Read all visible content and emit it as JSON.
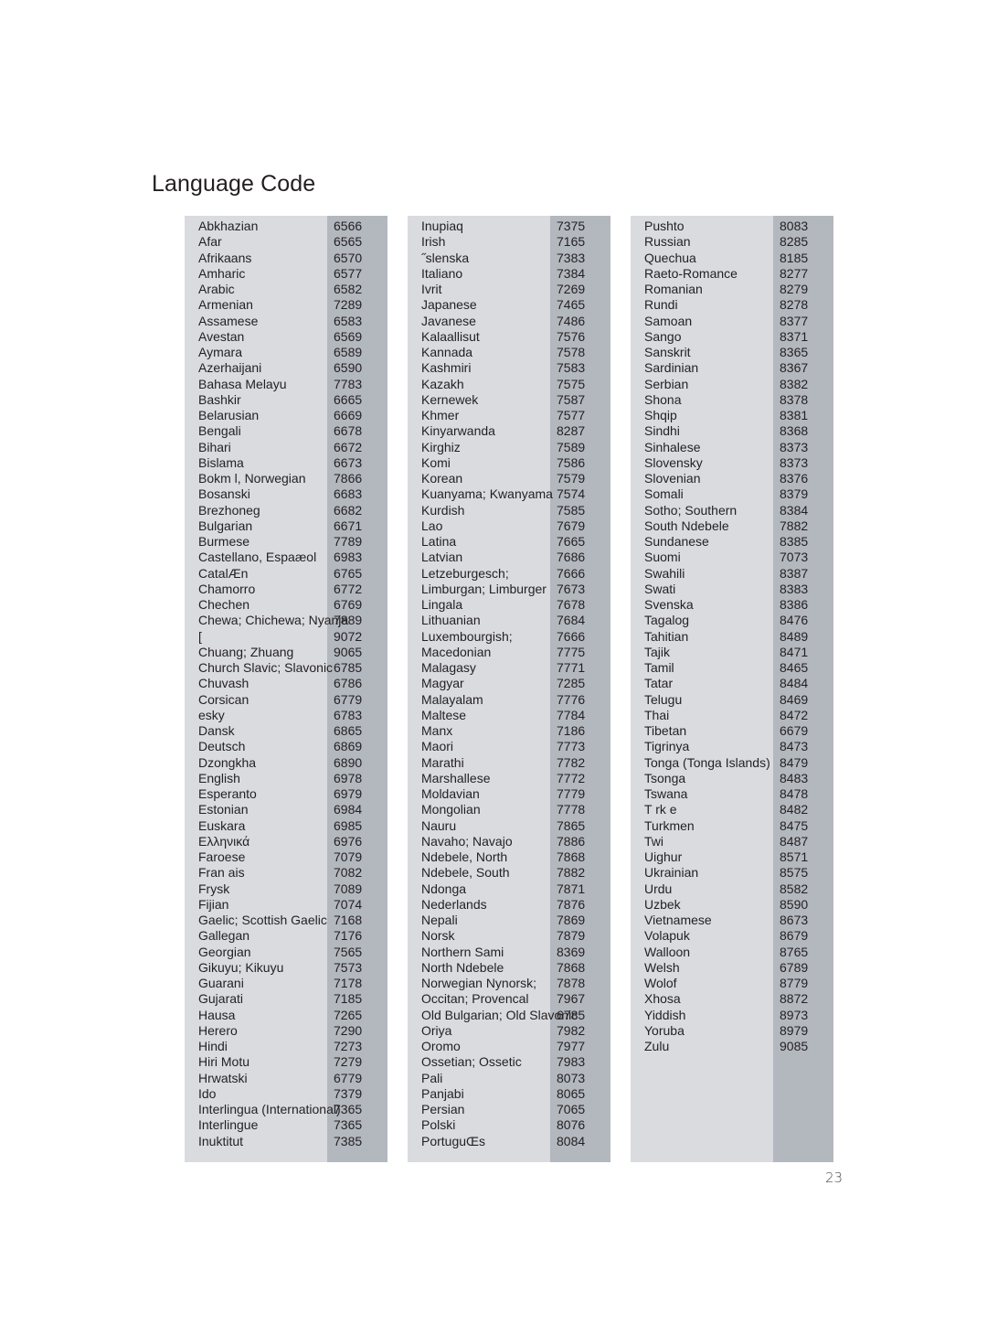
{
  "title": "Language Code",
  "page_number": "23",
  "colors": {
    "panel": "#d9dbdf",
    "code_band": "#b3b8bf",
    "text": "#231f20"
  },
  "columns": [
    {
      "rows": [
        {
          "name": "Abkhazian",
          "code": "6566"
        },
        {
          "name": "Afar",
          "code": "6565"
        },
        {
          "name": "Afrikaans",
          "code": "6570"
        },
        {
          "name": "Amharic",
          "code": "6577"
        },
        {
          "name": "Arabic",
          "code": "6582"
        },
        {
          "name": "Armenian",
          "code": "7289"
        },
        {
          "name": "Assamese",
          "code": "6583"
        },
        {
          "name": "Avestan",
          "code": "6569"
        },
        {
          "name": "Aymara",
          "code": "6589"
        },
        {
          "name": "Azerhaijani",
          "code": "6590"
        },
        {
          "name": "Bahasa Melayu",
          "code": "7783"
        },
        {
          "name": "Bashkir",
          "code": "6665"
        },
        {
          "name": "Belarusian",
          "code": "6669"
        },
        {
          "name": "Bengali",
          "code": "6678"
        },
        {
          "name": "Bihari",
          "code": "6672"
        },
        {
          "name": "Bislama",
          "code": "6673"
        },
        {
          "name": "Bokm l, Norwegian",
          "code": "7866"
        },
        {
          "name": "Bosanski",
          "code": "6683"
        },
        {
          "name": "Brezhoneg",
          "code": "6682"
        },
        {
          "name": "Bulgarian",
          "code": "6671"
        },
        {
          "name": "Burmese",
          "code": "7789"
        },
        {
          "name": "Castellano, Espaæol",
          "code": "6983"
        },
        {
          "name": "CatalÆn",
          "code": "6765"
        },
        {
          "name": "Chamorro",
          "code": "6772"
        },
        {
          "name": "Chechen",
          "code": "6769"
        },
        {
          "name": "Chewa; Chichewa; Nyanja",
          "code": "7889"
        },
        {
          "name": "  [",
          "code": "9072"
        },
        {
          "name": "Chuang; Zhuang",
          "code": "9065"
        },
        {
          "name": "Church Slavic; Slavonic",
          "code": "6785"
        },
        {
          "name": "Chuvash",
          "code": "6786"
        },
        {
          "name": "Corsican",
          "code": "6779"
        },
        {
          "name": " esky",
          "code": "6783"
        },
        {
          "name": "Dansk",
          "code": "6865"
        },
        {
          "name": "Deutsch",
          "code": "6869"
        },
        {
          "name": "Dzongkha",
          "code": "6890"
        },
        {
          "name": "English",
          "code": "6978"
        },
        {
          "name": "Esperanto",
          "code": "6979"
        },
        {
          "name": "Estonian",
          "code": "6984"
        },
        {
          "name": "Euskara",
          "code": "6985"
        },
        {
          "name": "Ελληνικά",
          "code": "6976"
        },
        {
          "name": "Faroese",
          "code": "7079"
        },
        {
          "name": "Fran ais",
          "code": "7082"
        },
        {
          "name": "Frysk",
          "code": "7089"
        },
        {
          "name": "Fijian",
          "code": "7074"
        },
        {
          "name": "Gaelic; Scottish Gaelic",
          "code": "7168"
        },
        {
          "name": "Gallegan",
          "code": "7176"
        },
        {
          "name": "Georgian",
          "code": "7565"
        },
        {
          "name": "Gikuyu; Kikuyu",
          "code": "7573"
        },
        {
          "name": "Guarani",
          "code": "7178"
        },
        {
          "name": "Gujarati",
          "code": "7185"
        },
        {
          "name": "Hausa",
          "code": "7265"
        },
        {
          "name": "Herero",
          "code": "7290"
        },
        {
          "name": "Hindi",
          "code": "7273"
        },
        {
          "name": "Hiri Motu",
          "code": "7279"
        },
        {
          "name": "Hrwatski",
          "code": "6779"
        },
        {
          "name": "Ido",
          "code": "7379"
        },
        {
          "name": "Interlingua (International)",
          "code": "7365"
        },
        {
          "name": "Interlingue",
          "code": "7365"
        },
        {
          "name": "Inuktitut",
          "code": "7385"
        }
      ]
    },
    {
      "rows": [
        {
          "name": "Inupiaq",
          "code": "7375"
        },
        {
          "name": "Irish",
          "code": "7165"
        },
        {
          "name": "˝slenska",
          "code": "7383"
        },
        {
          "name": "Italiano",
          "code": "7384"
        },
        {
          "name": "Ivrit",
          "code": "7269"
        },
        {
          "name": "Japanese",
          "code": "7465"
        },
        {
          "name": "Javanese",
          "code": "7486"
        },
        {
          "name": "Kalaallisut",
          "code": "7576"
        },
        {
          "name": "Kannada",
          "code": "7578"
        },
        {
          "name": "Kashmiri",
          "code": "7583"
        },
        {
          "name": "Kazakh",
          "code": "7575"
        },
        {
          "name": "Kernewek",
          "code": "7587"
        },
        {
          "name": "Khmer",
          "code": "7577"
        },
        {
          "name": "Kinyarwanda",
          "code": "8287"
        },
        {
          "name": "Kirghiz",
          "code": "7589"
        },
        {
          "name": "Komi",
          "code": "7586"
        },
        {
          "name": "Korean",
          "code": "7579"
        },
        {
          "name": "Kuanyama; Kwanyama",
          "code": "7574"
        },
        {
          "name": "Kurdish",
          "code": "7585"
        },
        {
          "name": "Lao",
          "code": "7679"
        },
        {
          "name": "Latina",
          "code": "7665"
        },
        {
          "name": "Latvian",
          "code": "7686"
        },
        {
          "name": "Letzeburgesch;",
          "code": "7666"
        },
        {
          "name": "Limburgan; Limburger",
          "code": "7673"
        },
        {
          "name": "Lingala",
          "code": "7678"
        },
        {
          "name": "Lithuanian",
          "code": "7684"
        },
        {
          "name": "Luxembourgish;",
          "code": "7666"
        },
        {
          "name": "Macedonian",
          "code": "7775"
        },
        {
          "name": "Malagasy",
          "code": "7771"
        },
        {
          "name": "Magyar",
          "code": "7285"
        },
        {
          "name": "Malayalam",
          "code": "7776"
        },
        {
          "name": "Maltese",
          "code": "7784"
        },
        {
          "name": "Manx",
          "code": "7186"
        },
        {
          "name": "Maori",
          "code": "7773"
        },
        {
          "name": "Marathi",
          "code": "7782"
        },
        {
          "name": "Marshallese",
          "code": "7772"
        },
        {
          "name": "Moldavian",
          "code": "7779"
        },
        {
          "name": "Mongolian",
          "code": "7778"
        },
        {
          "name": "Nauru",
          "code": "7865"
        },
        {
          "name": "Navaho; Navajo",
          "code": "7886"
        },
        {
          "name": "Ndebele, North",
          "code": "7868"
        },
        {
          "name": "Ndebele, South",
          "code": "7882"
        },
        {
          "name": "Ndonga",
          "code": "7871"
        },
        {
          "name": "Nederlands",
          "code": "7876"
        },
        {
          "name": "Nepali",
          "code": "7869"
        },
        {
          "name": "Norsk",
          "code": "7879"
        },
        {
          "name": "Northern Sami",
          "code": "8369"
        },
        {
          "name": "North Ndebele",
          "code": "7868"
        },
        {
          "name": "Norwegian Nynorsk;",
          "code": "7878"
        },
        {
          "name": "Occitan; Provencal",
          "code": "7967"
        },
        {
          "name": "Old Bulgarian; Old Slavonic",
          "code": "6785"
        },
        {
          "name": "Oriya",
          "code": "7982"
        },
        {
          "name": "Oromo",
          "code": "7977"
        },
        {
          "name": "Ossetian; Ossetic",
          "code": "7983"
        },
        {
          "name": "Pali",
          "code": "8073"
        },
        {
          "name": "Panjabi",
          "code": "8065"
        },
        {
          "name": "Persian",
          "code": "7065"
        },
        {
          "name": "Polski",
          "code": "8076"
        },
        {
          "name": "PortuguŒs",
          "code": "8084"
        }
      ]
    },
    {
      "rows": [
        {
          "name": "Pushto",
          "code": "8083"
        },
        {
          "name": "Russian",
          "code": "8285"
        },
        {
          "name": "Quechua",
          "code": "8185"
        },
        {
          "name": "Raeto-Romance",
          "code": "8277"
        },
        {
          "name": "Romanian",
          "code": "8279"
        },
        {
          "name": "Rundi",
          "code": "8278"
        },
        {
          "name": "Samoan",
          "code": "8377"
        },
        {
          "name": "Sango",
          "code": "8371"
        },
        {
          "name": "Sanskrit",
          "code": "8365"
        },
        {
          "name": "Sardinian",
          "code": "8367"
        },
        {
          "name": "Serbian",
          "code": "8382"
        },
        {
          "name": "Shona",
          "code": "8378"
        },
        {
          "name": "Shqip",
          "code": "8381"
        },
        {
          "name": "Sindhi",
          "code": "8368"
        },
        {
          "name": "Sinhalese",
          "code": "8373"
        },
        {
          "name": "Slovensky",
          "code": "8373"
        },
        {
          "name": "Slovenian",
          "code": "8376"
        },
        {
          "name": "Somali",
          "code": "8379"
        },
        {
          "name": "Sotho; Southern",
          "code": "8384"
        },
        {
          "name": "South Ndebele",
          "code": "7882"
        },
        {
          "name": "Sundanese",
          "code": "8385"
        },
        {
          "name": "Suomi",
          "code": "7073"
        },
        {
          "name": "Swahili",
          "code": "8387"
        },
        {
          "name": "Swati",
          "code": "8383"
        },
        {
          "name": "Svenska",
          "code": "8386"
        },
        {
          "name": "Tagalog",
          "code": "8476"
        },
        {
          "name": "Tahitian",
          "code": "8489"
        },
        {
          "name": "Tajik",
          "code": "8471"
        },
        {
          "name": "Tamil",
          "code": "8465"
        },
        {
          "name": "Tatar",
          "code": "8484"
        },
        {
          "name": "Telugu",
          "code": "8469"
        },
        {
          "name": "Thai",
          "code": "8472"
        },
        {
          "name": "Tibetan",
          "code": "6679"
        },
        {
          "name": "Tigrinya",
          "code": "8473"
        },
        {
          "name": "Tonga (Tonga Islands)",
          "code": "8479"
        },
        {
          "name": "Tsonga",
          "code": "8483"
        },
        {
          "name": "Tswana",
          "code": "8478"
        },
        {
          "name": "T rk e",
          "code": "8482"
        },
        {
          "name": "Turkmen",
          "code": "8475"
        },
        {
          "name": "Twi",
          "code": "8487"
        },
        {
          "name": "Uighur",
          "code": "8571"
        },
        {
          "name": "Ukrainian",
          "code": "8575"
        },
        {
          "name": "Urdu",
          "code": "8582"
        },
        {
          "name": "Uzbek",
          "code": "8590"
        },
        {
          "name": "Vietnamese",
          "code": "8673"
        },
        {
          "name": "Volapuk",
          "code": "8679"
        },
        {
          "name": "Walloon",
          "code": "8765"
        },
        {
          "name": "Welsh",
          "code": "6789"
        },
        {
          "name": "Wolof",
          "code": "8779"
        },
        {
          "name": "Xhosa",
          "code": "8872"
        },
        {
          "name": "Yiddish",
          "code": "8973"
        },
        {
          "name": "Yoruba",
          "code": "8979"
        },
        {
          "name": "Zulu",
          "code": "9085"
        }
      ]
    }
  ]
}
